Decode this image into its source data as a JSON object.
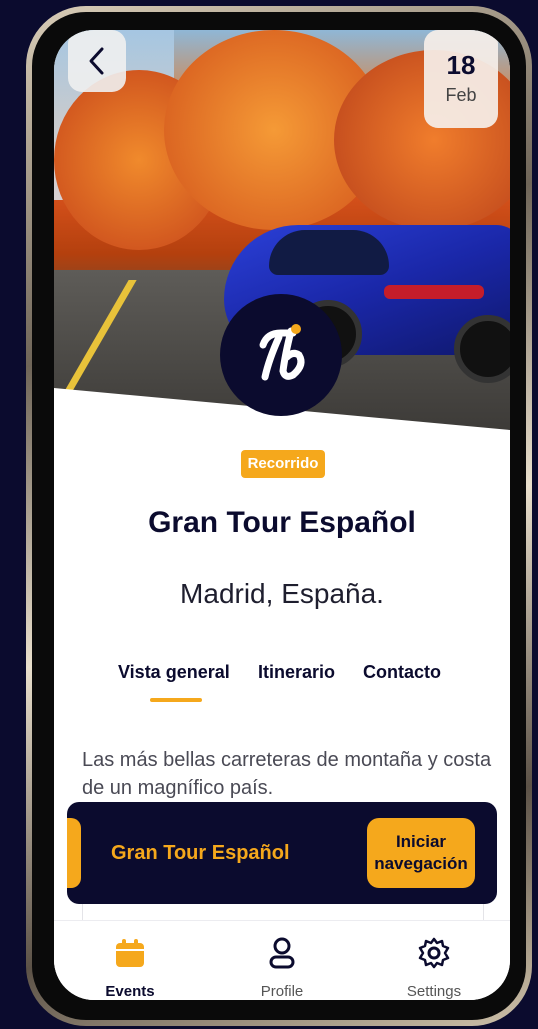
{
  "header": {
    "date_day": "18",
    "date_month": "Feb"
  },
  "event": {
    "category_badge": "Recorrido",
    "title": "Gran Tour Español",
    "location": "Madrid, España.",
    "description": "Las más bellas carreteras de montaña y costa de un magnífico país."
  },
  "tabs": [
    {
      "label": "Vista general",
      "active": true
    },
    {
      "label": "Itinerario",
      "active": false
    },
    {
      "label": "Contacto",
      "active": false
    }
  ],
  "navigation_bar": {
    "title": "Gran Tour Español",
    "start_button": "Iniciar navegación"
  },
  "bottom_nav": [
    {
      "label": "Events",
      "icon": "calendar-icon",
      "active": true
    },
    {
      "label": "Profile",
      "icon": "user-icon",
      "active": false
    },
    {
      "label": "Settings",
      "icon": "gear-icon",
      "active": false
    }
  ],
  "colors": {
    "brand_dark": "#0b0b2e",
    "accent": "#f5a81c"
  }
}
